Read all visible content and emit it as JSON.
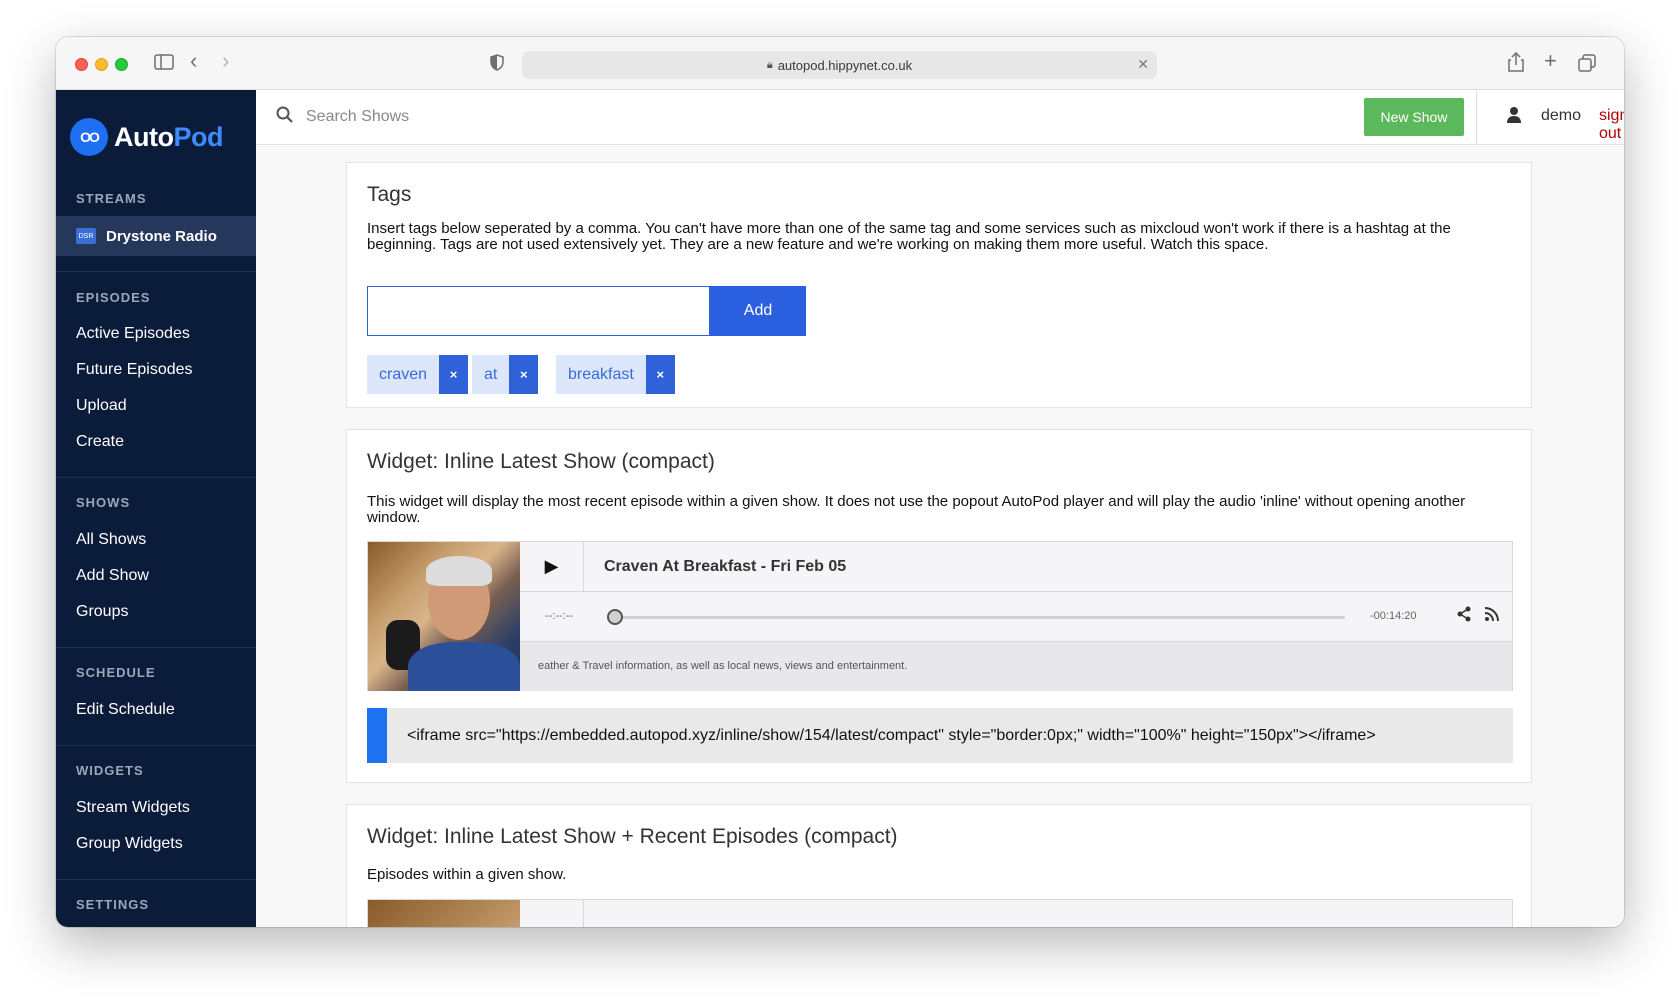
{
  "browser": {
    "url": "autopod.hippynet.co.uk"
  },
  "sidebar": {
    "logo_auto": "Auto",
    "logo_pod": "Pod",
    "logo_mark": "OO",
    "sections": {
      "streams": "STREAMS",
      "episodes": "EPISODES",
      "shows": "SHOWS",
      "schedule": "SCHEDULE",
      "widgets": "WIDGETS",
      "settings": "SETTINGS"
    },
    "active_stream": {
      "badge": "DSR",
      "label": "Drystone Radio"
    },
    "episodes": [
      "Active Episodes",
      "Future Episodes",
      "Upload",
      "Create"
    ],
    "shows": [
      "All Shows",
      "Add Show",
      "Groups"
    ],
    "schedule": [
      "Edit Schedule"
    ],
    "widgets": [
      "Stream Widgets",
      "Group Widgets"
    ]
  },
  "topbar": {
    "search_placeholder": "Search Shows",
    "new_show": "New Show",
    "user": "demo",
    "sign_out": "sign out"
  },
  "tags_panel": {
    "title": "Tags",
    "description": "Insert tags below seperated by a comma. You can't have more than one of the same tag and some services such as mixcloud won't work if there is a hashtag at the beginning. Tags are not used extensively yet. They are a new feature and we're working on making them more useful. Watch this space.",
    "input_value": "",
    "add_label": "Add",
    "tags": [
      "craven",
      "at",
      "breakfast"
    ],
    "remove_glyph": "×"
  },
  "widget_inline": {
    "title": "Widget: Inline Latest Show (compact)",
    "description": "This widget will display the most recent episode within a given show. It does not use the popout AutoPod player and will play the audio 'inline' without opening another window.",
    "player": {
      "episode_title": "Craven At Breakfast - Fri Feb 05",
      "time_elapsed": "--:--:--",
      "time_remaining": "-00:14:20",
      "progress": 0,
      "episode_description": "eather & Travel information, as well as local news, views and entertainment."
    },
    "embed_code": "<iframe src=\"https://embedded.autopod.xyz/inline/show/154/latest/compact\" style=\"border:0px;\" width=\"100%\" height=\"150px\"></iframe>"
  },
  "widget_recent": {
    "title": "Widget: Inline Latest Show + Recent Episodes (compact)",
    "description": "Episodes within a given show."
  },
  "colors": {
    "sidebar_bg": "#0b1b3a",
    "accent_blue": "#2a5fe0",
    "new_show_green": "#5cb85c",
    "sign_out_red": "#b30000"
  }
}
